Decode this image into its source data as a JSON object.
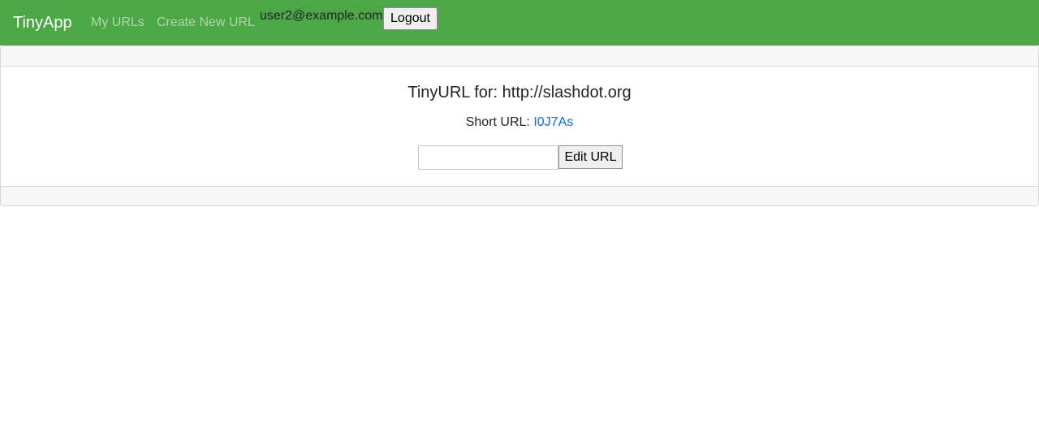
{
  "navbar": {
    "brand": "TinyApp",
    "links": [
      {
        "label": "My URLs"
      },
      {
        "label": "Create New URL"
      }
    ],
    "user_email": "user2@example.com",
    "logout_label": "Logout",
    "background": "#4ca746"
  },
  "card": {
    "title": "TinyURL for: http://slashdot.org",
    "short_url_label": "Short URL:",
    "short_url_value": "I0J7As",
    "edit_input_value": "",
    "edit_button_label": "Edit URL",
    "link_color": "#0b6de0"
  }
}
